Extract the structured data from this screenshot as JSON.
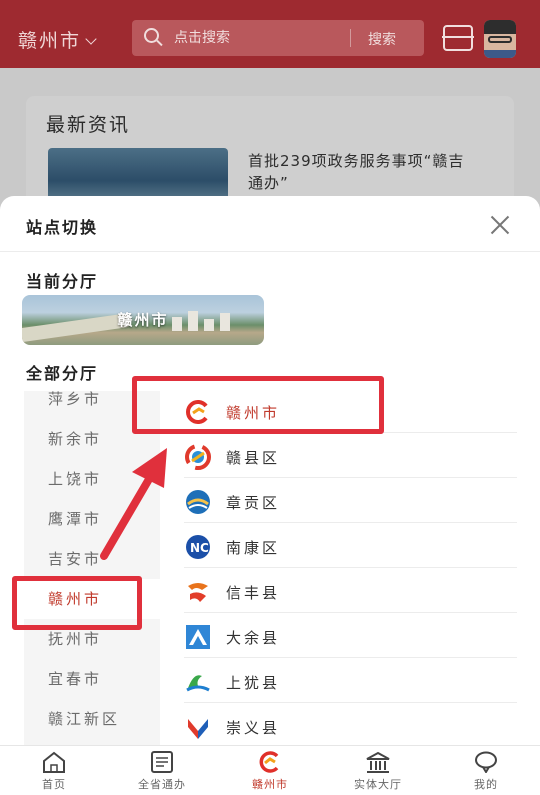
{
  "header": {
    "city": "赣州市",
    "search_placeholder": "点击搜索",
    "search_button": "搜索"
  },
  "news": {
    "section_title": "最新资讯",
    "headline": "首批239项政务服务事项“赣吉通办”"
  },
  "sheet": {
    "title": "站点切换",
    "current_label": "当前分厅",
    "current_city": "赣州市",
    "all_label": "全部分厅",
    "cities": [
      "萍乡市",
      "新余市",
      "上饶市",
      "鹰潭市",
      "吉安市",
      "赣州市",
      "抚州市",
      "宜春市",
      "赣江新区"
    ],
    "selected_city": "赣州市",
    "districts": [
      {
        "name": "赣州市",
        "logo": "ganzhou-logo-icon",
        "active": true
      },
      {
        "name": "赣县区",
        "logo": "ganxian-logo-icon",
        "active": false
      },
      {
        "name": "章贡区",
        "logo": "zhanggong-logo-icon",
        "active": false
      },
      {
        "name": "南康区",
        "logo": "nankang-logo-icon",
        "active": false
      },
      {
        "name": "信丰县",
        "logo": "xinfeng-logo-icon",
        "active": false
      },
      {
        "name": "大余县",
        "logo": "dayu-logo-icon",
        "active": false
      },
      {
        "name": "上犹县",
        "logo": "shangyou-logo-icon",
        "active": false
      },
      {
        "name": "崇义县",
        "logo": "chongyi-logo-icon",
        "active": false
      }
    ]
  },
  "tabbar": {
    "items": [
      {
        "label": "首页",
        "icon": "home-icon"
      },
      {
        "label": "全省通办",
        "icon": "document-list-icon"
      },
      {
        "label": "赣州市",
        "icon": "city-logo-icon",
        "active": true
      },
      {
        "label": "实体大厅",
        "icon": "hall-building-icon"
      },
      {
        "label": "我的",
        "icon": "chat-bubble-icon"
      }
    ]
  },
  "colors": {
    "brand_red": "#c0392b",
    "header_dimmed": "#9e2a30",
    "annotation_red": "#e0303c"
  }
}
